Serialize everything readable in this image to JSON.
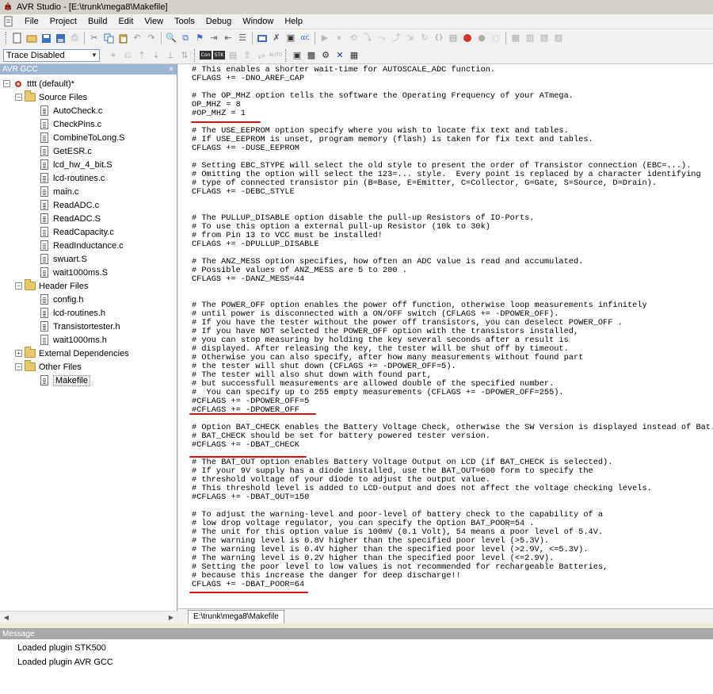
{
  "window": {
    "title": "AVR Studio - [E:\\trunk\\mega8\\Makefile]"
  },
  "menu": [
    "File",
    "Project",
    "Build",
    "Edit",
    "View",
    "Tools",
    "Debug",
    "Window",
    "Help"
  ],
  "toolbar2": {
    "combo_value": "Trace Disabled"
  },
  "left_panel": {
    "header": "AVR GCC",
    "tree": [
      {
        "label": "tttt (default)*",
        "kind": "project",
        "level": 0,
        "expander": "-"
      },
      {
        "label": "Source Files",
        "kind": "folder",
        "level": 1,
        "expander": "-"
      },
      {
        "label": "AutoCheck.c",
        "kind": "file",
        "level": 2
      },
      {
        "label": "CheckPins.c",
        "kind": "file",
        "level": 2
      },
      {
        "label": "CombineToLong.S",
        "kind": "file",
        "level": 2
      },
      {
        "label": "GetESR.c",
        "kind": "file",
        "level": 2
      },
      {
        "label": "lcd_hw_4_bit.S",
        "kind": "file",
        "level": 2
      },
      {
        "label": "lcd-routines.c",
        "kind": "file",
        "level": 2
      },
      {
        "label": "main.c",
        "kind": "file",
        "level": 2
      },
      {
        "label": "ReadADC.c",
        "kind": "file",
        "level": 2
      },
      {
        "label": "ReadADC.S",
        "kind": "file",
        "level": 2
      },
      {
        "label": "ReadCapacity.c",
        "kind": "file",
        "level": 2
      },
      {
        "label": "ReadInductance.c",
        "kind": "file",
        "level": 2
      },
      {
        "label": "swuart.S",
        "kind": "file",
        "level": 2
      },
      {
        "label": "wait1000ms.S",
        "kind": "file",
        "level": 2
      },
      {
        "label": "Header Files",
        "kind": "folder",
        "level": 1,
        "expander": "-"
      },
      {
        "label": "config.h",
        "kind": "file",
        "level": 2
      },
      {
        "label": "lcd-routines.h",
        "kind": "file",
        "level": 2
      },
      {
        "label": "Transistortester.h",
        "kind": "file",
        "level": 2
      },
      {
        "label": "wait1000ms.h",
        "kind": "file",
        "level": 2
      },
      {
        "label": "External Dependencies",
        "kind": "folder",
        "level": 1,
        "expander": "+"
      },
      {
        "label": "Other Files",
        "kind": "folder",
        "level": 1,
        "expander": "-"
      },
      {
        "label": "Makefile",
        "kind": "file",
        "level": 2,
        "selected": true
      }
    ]
  },
  "editor": {
    "tab_label": "E:\\trunk\\mega8\\Makefile",
    "lines": [
      "# This enables a shorter wait-time for AUTOSCALE_ADC function.",
      "CFLAGS += -DNO_AREF_CAP",
      "",
      "# The OP_MHZ option tells the software the Operating Frequency of your ATmega.",
      "OP_MHZ = 8",
      "#OP_MHZ = 1",
      "",
      "# The USE_EEPROM option specify where you wish to locate fix text and tables.",
      "# If USE_EEPROM is unset, program memory (flash) is taken for fix text and tables.",
      "CFLAGS += -DUSE_EEPROM",
      "",
      "# Setting EBC_STYPE will select the old style to present the order of Transistor connection (EBC=...).",
      "# Omitting the option will select the 123=... style.  Every point is replaced by a character identifying",
      "# type of connected transistor pin (B=Base, E=Emitter, C=Collector, G=Gate, S=Source, D=Drain).",
      "CFLAGS += -DEBC_STYLE",
      "",
      "",
      "# The PULLUP_DISABLE option disable the pull-up Resistors of IO-Ports.",
      "# To use this option a external pull-up Resistor (10k to 30k)",
      "# from Pin 13 to VCC must be installed!",
      "CFLAGS += -DPULLUP_DISABLE",
      "",
      "# The ANZ_MESS option specifies, how often an ADC value is read and accumulated.",
      "# Possible values of ANZ_MESS are 5 to 200 .",
      "CFLAGS += -DANZ_MESS=44",
      "",
      "",
      "# The POWER_OFF option enables the power off function, otherwise loop measurements infinitely",
      "# until power is disconnected with a ON/OFF switch (CFLAGS += -DPOWER_OFF).",
      "# If you have the tester without the power off transistors, you can deselect POWER_OFF .",
      "# If you have NOT selected the POWER_OFF option with the transistors installed,",
      "# you can stop measuring by holding the key several seconds after a result is",
      "# displayed. After releasing the key, the tester will be shut off by timeout.",
      "# Otherwise you can also specify, after how many measurements without found part",
      "# the tester will shut down (CFLAGS += -DPOWER_OFF=5).",
      "# The tester will also shut down with found part,",
      "# but successfull measurements are allowed double of the specified number.",
      "#  You can specify up to 255 empty measurements (CFLAGS += -DPOWER_OFF=255).",
      "#CFLAGS += -DPOWER_OFF=5",
      "#CFLAGS += -DPOWER_OFF",
      "",
      "# Option BAT_CHECK enables the Battery Voltage Check, otherwise the SW Version is displayed instead of Bat.",
      "# BAT_CHECK should be set for battery powered tester version.",
      "#CFLAGS += -DBAT_CHECK",
      "",
      "# The BAT_OUT option enables Battery Voltage Output on LCD (if BAT_CHECK is selected).",
      "# If your 9V supply has a diode installed, use the BAT_OUT=600 form to specify the",
      "# threshold voltage of your diode to adjust the output value.",
      "# This threshold level is added to LCD-output and does not affect the voltage checking levels.",
      "#CFLAGS += -DBAT_OUT=150",
      "",
      "# To adjust the warning-level and poor-level of battery check to the capability of a",
      "# low drop voltage regulator, you can specify the Option BAT_POOR=54 .",
      "# The unit for this option value is 100mV (0.1 Volt), 54 means a poor level of 5.4V.",
      "# The warning level is 0.8V higher than the specified poor level (>5.3V).",
      "# The warning level is 0.4V higher than the specified poor level (>2.9V, <=5.3V).",
      "# The warning level is 0.2V higher than the specified poor level (<=2.9V).",
      "# Setting the poor level to low values is not recommended for rechargeable Batteries,",
      "# because this increase the danger for deep discharge!!",
      "CFLAGS += -DBAT_POOR=64"
    ],
    "annotation_color": "#e01010"
  },
  "message_panel": {
    "header": "Message",
    "lines": [
      "Loaded plugin STK500",
      "Loaded plugin AVR GCC"
    ]
  }
}
